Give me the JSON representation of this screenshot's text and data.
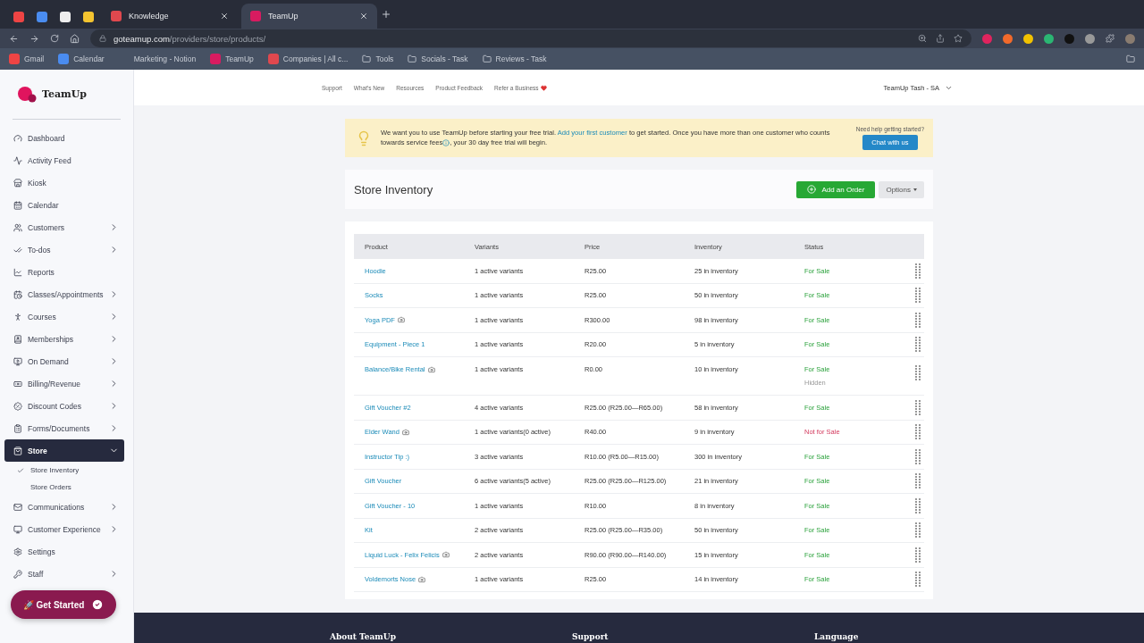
{
  "browser": {
    "tabs": [
      {
        "label": "Knowledge",
        "selected": false
      },
      {
        "label": "TeamUp",
        "selected": true
      }
    ],
    "address": {
      "host": "goteamup.com",
      "path": "/providers/store/products/"
    },
    "bookmarks": [
      "Gmail",
      "Calendar",
      "Marketing - Notion",
      "TeamUp",
      "Companies | All c...",
      "Tools",
      "Socials - Task",
      "Reviews - Task"
    ]
  },
  "sidebar": {
    "brand": "TeamUp",
    "items": [
      {
        "label": "Dashboard",
        "expandable": false,
        "selected": false
      },
      {
        "label": "Activity Feed",
        "expandable": false,
        "selected": false
      },
      {
        "label": "Kiosk",
        "expandable": false,
        "selected": false
      },
      {
        "label": "Calendar",
        "expandable": false,
        "selected": false
      },
      {
        "label": "Customers",
        "expandable": true,
        "selected": false
      },
      {
        "label": "To-dos",
        "expandable": true,
        "selected": false
      },
      {
        "label": "Reports",
        "expandable": false,
        "selected": false
      },
      {
        "label": "Classes/Appointments",
        "expandable": true,
        "selected": false
      },
      {
        "label": "Courses",
        "expandable": true,
        "selected": false
      },
      {
        "label": "Memberships",
        "expandable": true,
        "selected": false
      },
      {
        "label": "On Demand",
        "expandable": true,
        "selected": false
      },
      {
        "label": "Billing/Revenue",
        "expandable": true,
        "selected": false
      },
      {
        "label": "Discount Codes",
        "expandable": true,
        "selected": false
      },
      {
        "label": "Forms/Documents",
        "expandable": true,
        "selected": false
      },
      {
        "label": "Store",
        "expandable": true,
        "selected": true,
        "expanded": true,
        "children": [
          {
            "label": "Store Inventory",
            "selected": true
          },
          {
            "label": "Store Orders",
            "selected": false
          }
        ]
      },
      {
        "label": "Communications",
        "expandable": true,
        "selected": false
      },
      {
        "label": "Customer Experience",
        "expandable": true,
        "selected": false
      },
      {
        "label": "Settings",
        "expandable": false,
        "selected": false
      },
      {
        "label": "Staff",
        "expandable": true,
        "selected": false
      }
    ],
    "cta": "🚀 Get Started"
  },
  "topnav": {
    "links": [
      "Support",
      "What's New",
      "Resources",
      "Product Feedback",
      "Refer a Business"
    ],
    "account": "TeamUp Tash - SA"
  },
  "banner": {
    "text_before": "We want you to use TeamUp before starting your free trial.",
    "link": "Add your first customer",
    "text_middle": "to get started. Once you have more than one customer who counts towards service fees",
    "text_after": ", your 30 day free trial will begin.",
    "help": "Need help getting started?",
    "button": "Chat with us"
  },
  "page": {
    "title": "Store Inventory",
    "primary_button": "Add an Order",
    "options_button": "Options"
  },
  "table": {
    "columns": [
      "Product",
      "Variants",
      "Price",
      "Inventory",
      "Status"
    ],
    "rows": [
      {
        "product": "Hoodie",
        "has_image": false,
        "variants": "1 active variants",
        "price": "R25.00",
        "inventory": "25 in inventory",
        "status": "For Sale",
        "for_sale": true,
        "hidden": false
      },
      {
        "product": "Socks",
        "has_image": false,
        "variants": "1 active variants",
        "price": "R25.00",
        "inventory": "50 in inventory",
        "status": "For Sale",
        "for_sale": true,
        "hidden": false
      },
      {
        "product": "Yoga PDF",
        "has_image": true,
        "variants": "1 active variants",
        "price": "R300.00",
        "inventory": "98 in inventory",
        "status": "For Sale",
        "for_sale": true,
        "hidden": false
      },
      {
        "product": "Equipment - Piece 1",
        "has_image": false,
        "variants": "1 active variants",
        "price": "R20.00",
        "inventory": "5 in inventory",
        "status": "For Sale",
        "for_sale": true,
        "hidden": false
      },
      {
        "product": "Balance/Bike Rental",
        "has_image": true,
        "variants": "1 active variants",
        "price": "R0.00",
        "inventory": "10 in inventory",
        "status": "For Sale",
        "for_sale": true,
        "hidden": true,
        "hidden_label": "Hidden"
      },
      {
        "product": "Gift Voucher #2",
        "has_image": false,
        "variants": "4 active variants",
        "price": "R25.00 (R25.00—R65.00)",
        "inventory": "58 in inventory",
        "status": "For Sale",
        "for_sale": true,
        "hidden": false
      },
      {
        "product": "Elder Wand",
        "has_image": true,
        "variants": "1 active variants(0 active)",
        "price": "R40.00",
        "inventory": "9 in inventory",
        "status": "Not for Sale",
        "for_sale": false,
        "hidden": false
      },
      {
        "product": "Instructor Tip :)",
        "has_image": false,
        "variants": "3 active variants",
        "price": "R10.00 (R5.00—R15.00)",
        "inventory": "300 in inventory",
        "status": "For Sale",
        "for_sale": true,
        "hidden": false
      },
      {
        "product": "Gift Voucher",
        "has_image": false,
        "variants": "6 active variants(5 active)",
        "price": "R25.00 (R25.00—R125.00)",
        "inventory": "21 in inventory",
        "status": "For Sale",
        "for_sale": true,
        "hidden": false
      },
      {
        "product": "Gift Voucher - 10",
        "has_image": false,
        "variants": "1 active variants",
        "price": "R10.00",
        "inventory": "8 in inventory",
        "status": "For Sale",
        "for_sale": true,
        "hidden": false
      },
      {
        "product": "Kit",
        "has_image": false,
        "variants": "2 active variants",
        "price": "R25.00 (R25.00—R35.00)",
        "inventory": "50 in inventory",
        "status": "For Sale",
        "for_sale": true,
        "hidden": false
      },
      {
        "product": "Liquid Luck - Felix Felicis",
        "has_image": true,
        "variants": "2 active variants",
        "price": "R90.00 (R90.00—R140.00)",
        "inventory": "15 in inventory",
        "status": "For Sale",
        "for_sale": true,
        "hidden": false
      },
      {
        "product": "Voldemorts Nose",
        "has_image": true,
        "variants": "1 active variants",
        "price": "R25.00",
        "inventory": "14 in inventory",
        "status": "For Sale",
        "for_sale": true,
        "hidden": false
      }
    ]
  },
  "footer": {
    "headings": [
      "About TeamUp",
      "Support",
      "Language"
    ]
  }
}
